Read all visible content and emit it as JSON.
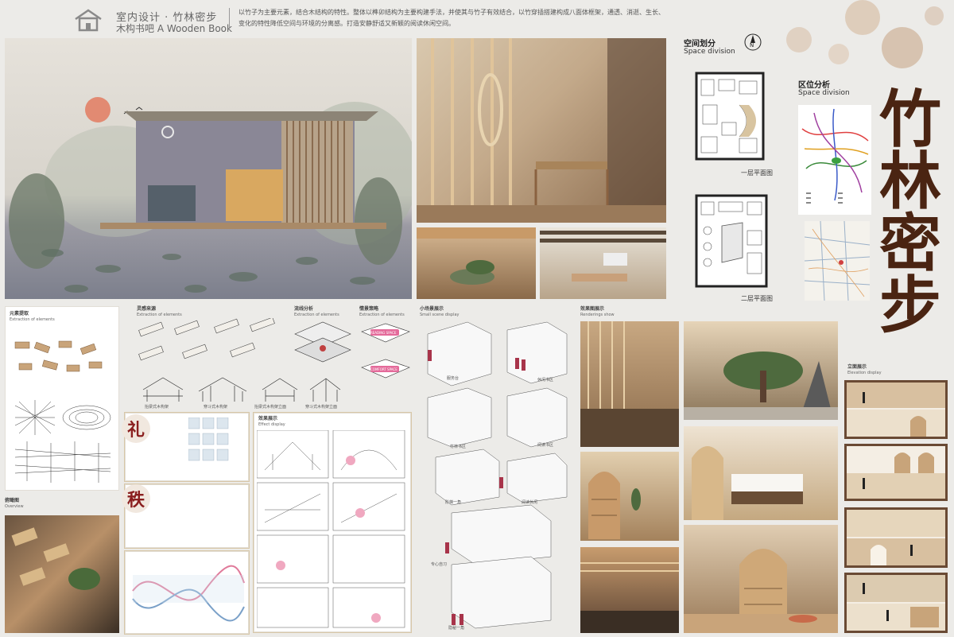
{
  "header": {
    "title_cn": "室内设计 · 竹林密步",
    "subtitle": "木构书吧  A Wooden Book",
    "description": "以竹子为主要元素，结合木结构的特性。整体以榫卯结构为主要构建手法，并使其与竹子有效结合，以竹穿插搭建构成八面体框架，通透、消逝、生长、变化的特性降低空间与环境的分离感。打造安静舒适又新颖的阅读休闲空间。"
  },
  "title_chars": [
    "竹",
    "林",
    "密",
    "步"
  ],
  "space_division": {
    "title_cn": "空间划分",
    "title_en": "Space division",
    "north": "N",
    "floor1": "一层平面图",
    "floor2": "二层平面图"
  },
  "location": {
    "title_cn": "区位分析",
    "title_en": "Space division"
  },
  "sections": {
    "elements": {
      "cn": "元素提取",
      "en": "Extraction of elements"
    },
    "evolution": {
      "cn": "灵感来源",
      "en": "Extraction of elements"
    },
    "flow": {
      "cn": "流线分析",
      "en": "Extraction of elements"
    },
    "strategy": {
      "cn": "情景策略",
      "en": "Extraction of elements"
    },
    "small_scene": {
      "cn": "小场景展示",
      "en": "Small scene display"
    },
    "renderings": {
      "cn": "效果图展示",
      "en": "Renderings show"
    },
    "effect": {
      "cn": "效果展示",
      "en": "Effect display"
    },
    "elevation": {
      "cn": "立面展示",
      "en": "Elevation display"
    },
    "overview": {
      "cn": "俯瞰图",
      "en": "Overview"
    }
  },
  "structure_labels": [
    "抬梁式木构架",
    "穿斗式木构架",
    "抬梁式木构架立面",
    "穿斗式木构架立面"
  ],
  "seals": [
    "礼",
    "秩"
  ],
  "scene_labels": [
    "服务台",
    "休闲书区",
    "竹林书区",
    "阅读书区",
    "阶梯一角",
    "阅读休闲",
    "专心自习",
    "隐秘一角"
  ],
  "strategy_labels": [
    "READING SPACE",
    "COMFORT SPACE"
  ],
  "colors": {
    "title_brown": "#4a2412",
    "seal_red": "#8a1f1f",
    "wood": "#c9a47a",
    "panel_border": "#d8c7a8"
  }
}
